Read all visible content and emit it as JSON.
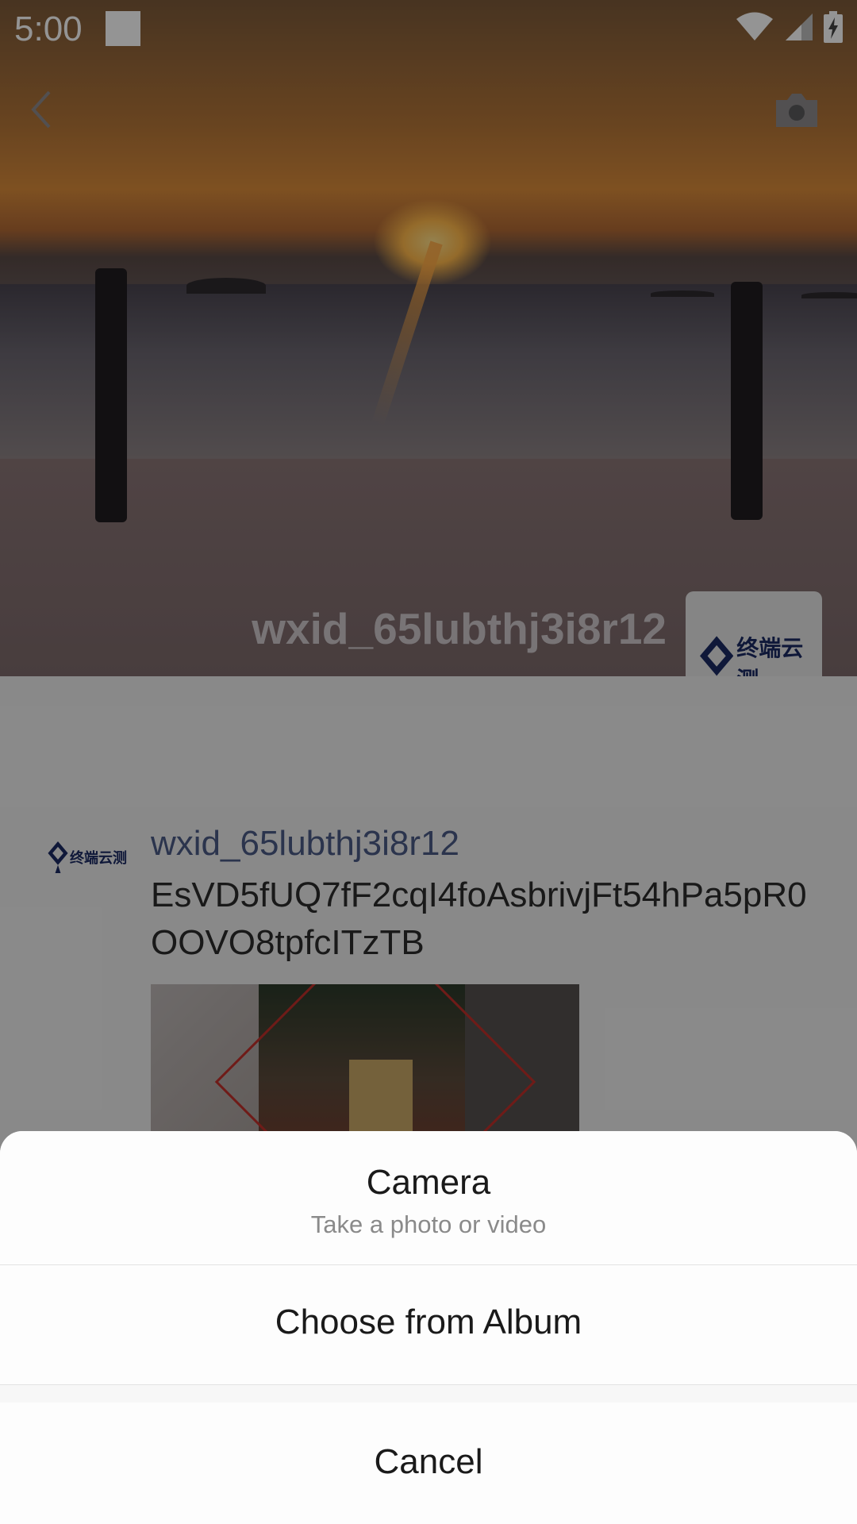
{
  "status_bar": {
    "time": "5:00"
  },
  "profile": {
    "cover_name": "wxid_65lubthj3i8r12",
    "avatar_logo_text": "终端云测"
  },
  "post": {
    "author": "wxid_65lubthj3i8r12",
    "text": "EsVD5fUQ7fF2cqI4foAsbrivjFt54hPa5pR0OOVO8tpfcITzTB",
    "avatar_logo_text": "终端云测"
  },
  "action_sheet": {
    "camera_title": "Camera",
    "camera_subtitle": "Take a photo or video",
    "album_label": "Choose from Album",
    "cancel_label": "Cancel"
  },
  "icons": [
    "back-icon",
    "camera-icon",
    "wifi-icon",
    "cell-signal-icon",
    "battery-charging-icon"
  ]
}
